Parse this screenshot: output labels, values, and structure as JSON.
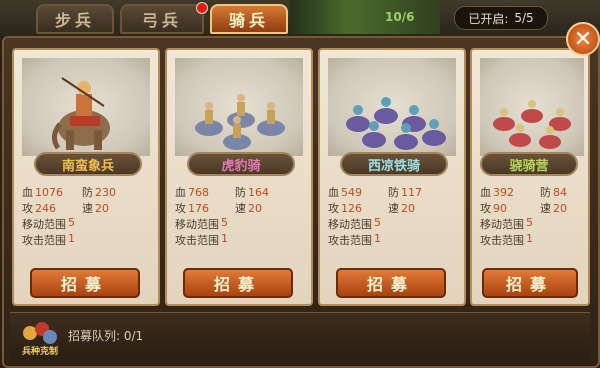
{
  "tabs": [
    {
      "label": "步兵",
      "active": false,
      "badge": false
    },
    {
      "label": "弓兵",
      "active": false,
      "badge": true
    },
    {
      "label": "骑兵",
      "active": true,
      "badge": false
    }
  ],
  "header": {
    "scene_number": "10/6",
    "opened_label": "已开启:",
    "opened_value": "5/5"
  },
  "close_icon": "close-x-icon",
  "units": [
    {
      "name": "南蛮象兵",
      "name_color": "#f0c050",
      "blood": "1076",
      "defense": "230",
      "attack": "246",
      "speed": "20",
      "move_range": "5",
      "attack_range": "1",
      "recruit_label": "招募",
      "troop_color": "#c9743a"
    },
    {
      "name": "虎豹骑",
      "name_color": "#e07ab7",
      "blood": "768",
      "defense": "164",
      "attack": "176",
      "speed": "20",
      "move_range": "5",
      "attack_range": "1",
      "recruit_label": "招募",
      "troop_color": "#7a86a8"
    },
    {
      "name": "西凉铁骑",
      "name_color": "#9ee0e6",
      "blood": "549",
      "defense": "117",
      "attack": "126",
      "speed": "20",
      "move_range": "5",
      "attack_range": "1",
      "recruit_label": "招募",
      "troop_color": "#6a5aa0"
    },
    {
      "name": "骁骑营",
      "name_color": "#b5d65a",
      "blood": "392",
      "defense": "84",
      "attack": "90",
      "speed": "20",
      "move_range": "5",
      "attack_range": "1",
      "recruit_label": "招募",
      "troop_color": "#c04a4a"
    }
  ],
  "stat_labels": {
    "blood": "血",
    "defense": "防",
    "attack": "攻",
    "speed": "速",
    "move_range": "移动范围",
    "attack_range": "攻击范围"
  },
  "queue": {
    "label": "招募队列:",
    "value": "0/1",
    "icon_label": "兵种克制"
  }
}
